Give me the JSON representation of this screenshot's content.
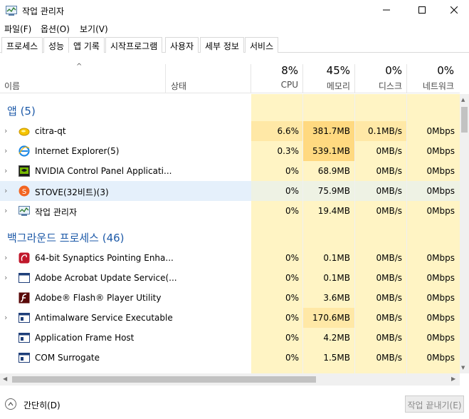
{
  "window": {
    "title": "작업 관리자",
    "minimize_icon": "minimize-icon",
    "maximize_icon": "maximize-icon",
    "close_icon": "close-icon"
  },
  "menu": [
    "파일(F)",
    "옵션(O)",
    "보기(V)"
  ],
  "tabs": [
    "프로세스",
    "성능",
    "앱 기록",
    "시작프로그램",
    "사용자",
    "세부 정보",
    "서비스"
  ],
  "active_tab": "프로세스",
  "columns": {
    "name": "이름",
    "status": "상태",
    "cpu": {
      "pct": "8%",
      "label": "CPU"
    },
    "memory": {
      "pct": "45%",
      "label": "메모리"
    },
    "disk": {
      "pct": "0%",
      "label": "디스크"
    },
    "network": {
      "pct": "0%",
      "label": "네트워크"
    }
  },
  "groups": {
    "apps": "앱 (5)",
    "background": "백그라운드 프로세스 (46)"
  },
  "apps": [
    {
      "name": "citra-qt",
      "icon": "citra-icon",
      "cpu": "6.6%",
      "mem": "381.7MB",
      "disk": "0.1MB/s",
      "net": "0Mbps"
    },
    {
      "name": "Internet Explorer(5)",
      "icon": "internet-explorer-icon",
      "cpu": "0.3%",
      "mem": "539.1MB",
      "disk": "0MB/s",
      "net": "0Mbps"
    },
    {
      "name": "NVIDIA Control Panel Applicati...",
      "icon": "nvidia-icon",
      "cpu": "0%",
      "mem": "68.9MB",
      "disk": "0MB/s",
      "net": "0Mbps"
    },
    {
      "name": "STOVE(32비트)(3)",
      "icon": "stove-icon",
      "cpu": "0%",
      "mem": "75.9MB",
      "disk": "0MB/s",
      "net": "0Mbps"
    },
    {
      "name": "작업 관리자",
      "icon": "task-manager-icon",
      "cpu": "0%",
      "mem": "19.4MB",
      "disk": "0MB/s",
      "net": "0Mbps"
    }
  ],
  "background": [
    {
      "name": "64-bit Synaptics Pointing Enha...",
      "icon": "synaptics-icon",
      "cpu": "0%",
      "mem": "0.1MB",
      "disk": "0MB/s",
      "net": "0Mbps"
    },
    {
      "name": "Adobe Acrobat Update Service(...",
      "icon": "service-window-icon",
      "cpu": "0%",
      "mem": "0.1MB",
      "disk": "0MB/s",
      "net": "0Mbps"
    },
    {
      "name": "Adobe® Flash® Player Utility",
      "icon": "flash-icon",
      "cpu": "0%",
      "mem": "3.6MB",
      "disk": "0MB/s",
      "net": "0Mbps"
    },
    {
      "name": "Antimalware Service Executable",
      "icon": "service-window-icon",
      "cpu": "0%",
      "mem": "170.6MB",
      "disk": "0MB/s",
      "net": "0Mbps"
    },
    {
      "name": "Application Frame Host",
      "icon": "service-window-icon",
      "cpu": "0%",
      "mem": "4.2MB",
      "disk": "0MB/s",
      "net": "0Mbps"
    },
    {
      "name": "COM Surrogate",
      "icon": "service-window-icon",
      "cpu": "0%",
      "mem": "1.5MB",
      "disk": "0MB/s",
      "net": "0Mbps"
    }
  ],
  "footer": {
    "fewer_details": "간단히(D)",
    "end_task": "작업 끝내기(E)"
  },
  "colors": {
    "heat_light": "#fff4c4",
    "heat_medium": "#ffe8a6",
    "heat_strong": "#ffd980",
    "group_title": "#1e5aa8",
    "selection": "#e5f0fb"
  }
}
